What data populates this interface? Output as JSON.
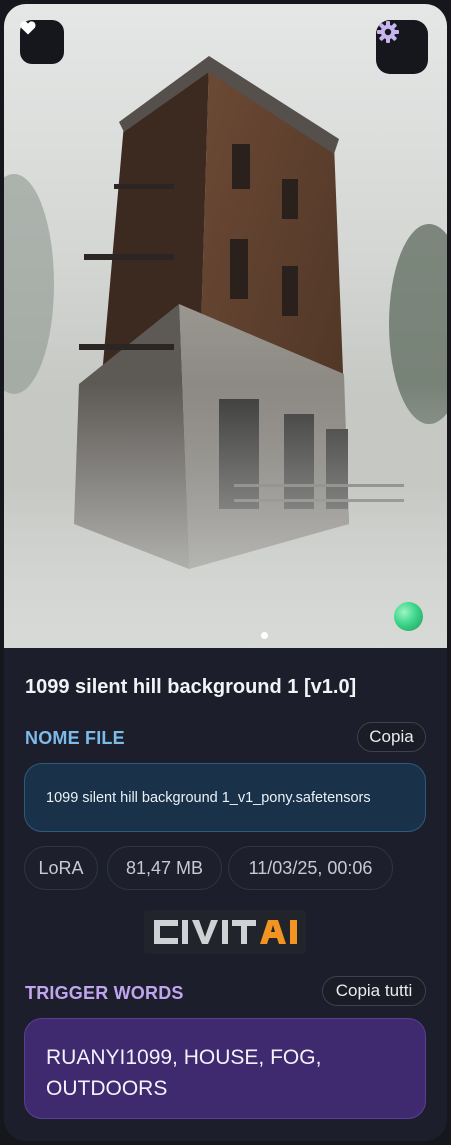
{
  "model": {
    "title": "1099 silent hill background 1 [v1.0]",
    "filename": "1099 silent hill background 1_v1_pony.safetensors",
    "type": "LoRA",
    "size": "81,47 MB",
    "date": "11/03/25, 00:06",
    "source_logo": "CIVITAI"
  },
  "labels": {
    "file_section": "NOME FILE",
    "copy": "Copia",
    "trigger_section": "TRIGGER WORDS",
    "copy_all": "Copia tutti"
  },
  "trigger_words": "RUANYI1099, HOUSE, FOG, OUTDOORS",
  "carousel": {
    "current": 1,
    "total": 1
  },
  "icons": {
    "favorite": "heart-icon",
    "settings": "gear-icon"
  },
  "colors": {
    "card_bg": "#1c1f2b",
    "file_accent": "#7cbbea",
    "trigger_accent": "#c0a6ee",
    "filename_bg": "#193149",
    "trigger_bg": "#3f2a70",
    "logo_orange": "#f39321"
  }
}
